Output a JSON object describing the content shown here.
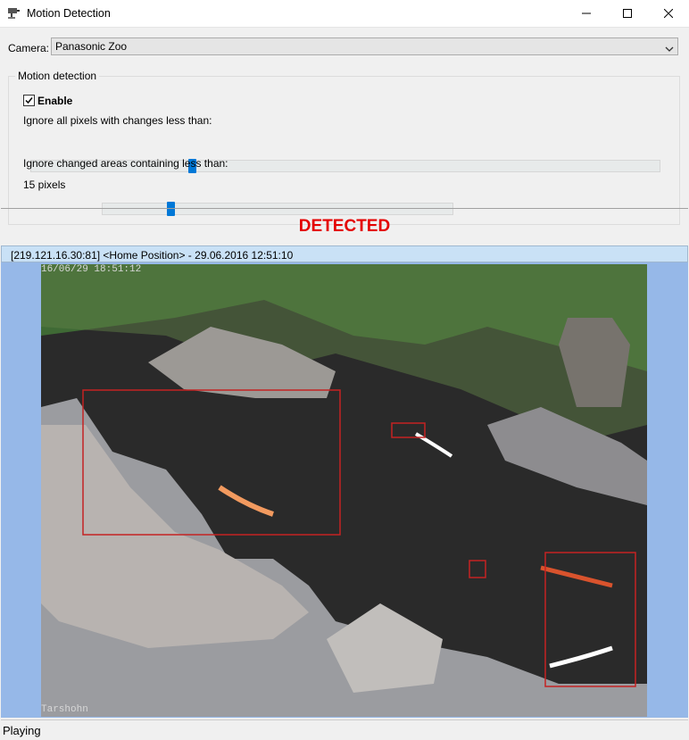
{
  "window": {
    "title": "Motion Detection",
    "icon": "camera-icon"
  },
  "camera": {
    "label": "Camera:",
    "value": "Panasonic Zoo"
  },
  "motion": {
    "group_title": "Motion detection",
    "enable_label": "Enable",
    "enabled": true,
    "pixel_change_label": "Ignore all pixels with changes less than:",
    "pixel_change_fraction": 0.25,
    "area_label": "Ignore changed areas containing less than:",
    "area_value": "15 pixels",
    "area_fraction": 0.19
  },
  "status": {
    "detected": "DETECTED",
    "playing": "Playing"
  },
  "video": {
    "header": "[219.121.16.30:81] <Home Position> - 29.06.2016 12:51:10",
    "overlay_top": "16/06/29 18:51:12",
    "overlay_bottom": "Tarshohn",
    "boxes_count": 4
  },
  "colors": {
    "detected": "#e40000",
    "accent": "#0078d7",
    "video_bg": "#96b8e8"
  }
}
